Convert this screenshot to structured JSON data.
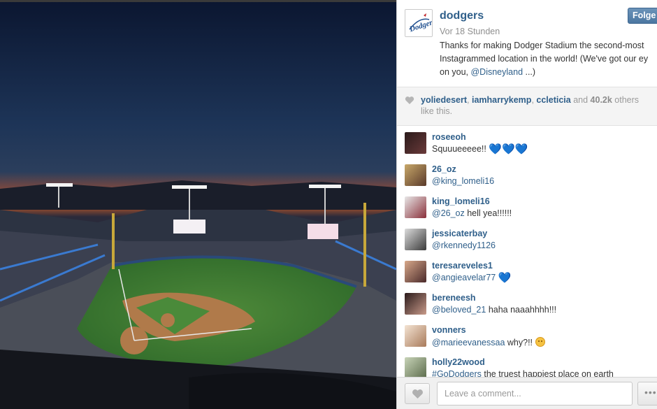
{
  "post": {
    "username": "dodgers",
    "time": "Vor 18 Stunden",
    "follow_label": "Folge",
    "avatar_logo": "Dodgers",
    "caption_line1": "Thanks for making Dodger Stadium the second-most",
    "caption_line2": "Instagrammed location in the world! (We've got our ey",
    "caption_line3_prefix": "on you, ",
    "caption_mention": "@Disneyland",
    "caption_line3_suffix": " ...)"
  },
  "likes": {
    "user1": "yoliedesert",
    "user2": "iamharrykemp",
    "user3": "ccleticia",
    "and": " and ",
    "count": "40.2k",
    "rest": " others like this.",
    "icon": "heart-icon"
  },
  "comments": [
    {
      "user": "roseeoh",
      "mention": "",
      "text": "Squuueeeee!! ",
      "emoji": "💙💙💙",
      "avatar_color": "#5a2b2b"
    },
    {
      "user": "26_oz",
      "mention": "@king_lomeli16",
      "text": "",
      "emoji": "",
      "avatar_color": "#8a6a3a"
    },
    {
      "user": "king_lomeli16",
      "mention": "@26_oz",
      "text": " hell yea!!!!!!",
      "emoji": "",
      "avatar_color": "#8a2f3a"
    },
    {
      "user": "jessicaterbay",
      "mention": "@rkennedy1126",
      "text": "",
      "emoji": "",
      "avatar_color": "#6a6a6a"
    },
    {
      "user": "teresareveles1",
      "mention": "@angieavelar77",
      "text": " ",
      "emoji": "💙",
      "avatar_color": "#7a4a3a"
    },
    {
      "user": "bereneesh",
      "mention": "@beloved_21",
      "text": " haha naaahhhh!!!",
      "emoji": "",
      "avatar_color": "#3a2a2a"
    },
    {
      "user": "vonners",
      "mention": "@marieevanessaa",
      "text": " why?!! ",
      "emoji": "face",
      "avatar_color": "#b89a7a"
    },
    {
      "user": "holly22wood",
      "mention": "#GoDodgers",
      "text": " the truest happiest place on earth",
      "emoji": "",
      "avatar_color": "#7a8a6a"
    }
  ],
  "footer": {
    "comment_placeholder": "Leave a comment...",
    "more_label": "•••"
  },
  "colors": {
    "link_blue": "#2f5f8a",
    "follow_button": "#4c77a1",
    "sky_top": "#0d1a33",
    "field_green": "#3f7a34"
  }
}
